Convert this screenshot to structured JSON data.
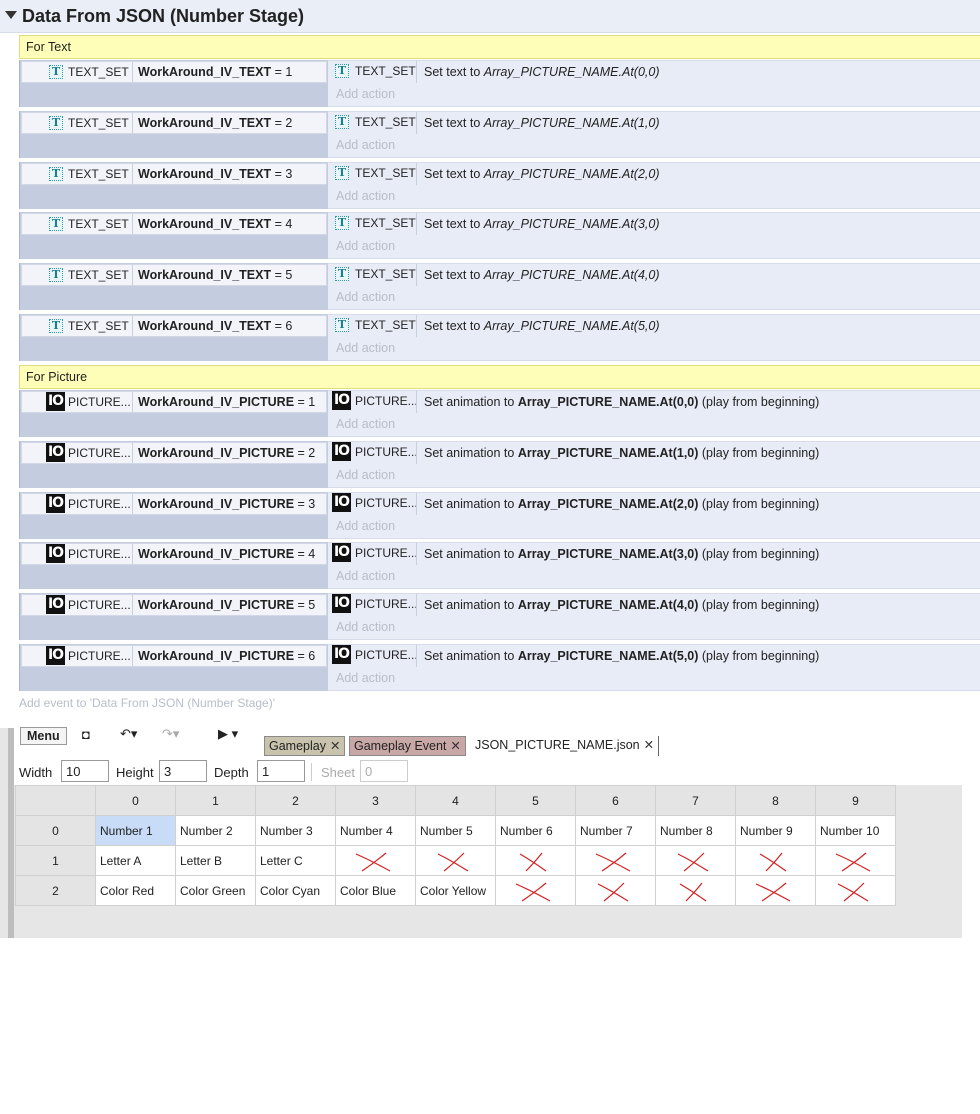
{
  "group": {
    "title": "Data From JSON (Number Stage)",
    "add_event": "Add event to 'Data From JSON (Number Stage)'"
  },
  "text_section": {
    "label": "For Text",
    "events": [
      {
        "obj": "TEXT_SET",
        "var": "WorkAround_IV_TEXT",
        "op": " = 1",
        "act_obj": "TEXT_SET",
        "act_prefix": "Set text to ",
        "act_expr": "Array_PICTURE_NAME.At(0,0)",
        "add_action": "Add action"
      },
      {
        "obj": "TEXT_SET",
        "var": "WorkAround_IV_TEXT",
        "op": " = 2",
        "act_obj": "TEXT_SET",
        "act_prefix": "Set text to ",
        "act_expr": "Array_PICTURE_NAME.At(1,0)",
        "add_action": "Add action"
      },
      {
        "obj": "TEXT_SET",
        "var": "WorkAround_IV_TEXT",
        "op": " = 3",
        "act_obj": "TEXT_SET",
        "act_prefix": "Set text to ",
        "act_expr": "Array_PICTURE_NAME.At(2,0)",
        "add_action": "Add action"
      },
      {
        "obj": "TEXT_SET",
        "var": "WorkAround_IV_TEXT",
        "op": " = 4",
        "act_obj": "TEXT_SET",
        "act_prefix": "Set text to ",
        "act_expr": "Array_PICTURE_NAME.At(3,0)",
        "add_action": "Add action"
      },
      {
        "obj": "TEXT_SET",
        "var": "WorkAround_IV_TEXT",
        "op": " = 5",
        "act_obj": "TEXT_SET",
        "act_prefix": "Set text to ",
        "act_expr": "Array_PICTURE_NAME.At(4,0)",
        "add_action": "Add action"
      },
      {
        "obj": "TEXT_SET",
        "var": "WorkAround_IV_TEXT",
        "op": " = 6",
        "act_obj": "TEXT_SET",
        "act_prefix": "Set text to ",
        "act_expr": "Array_PICTURE_NAME.At(5,0)",
        "add_action": "Add action"
      }
    ]
  },
  "picture_section": {
    "label": "For Picture",
    "events": [
      {
        "obj": "PICTURE...",
        "var": "WorkAround_IV_PICTURE",
        "op": " = 1",
        "act_obj": "PICTURE...",
        "act_prefix": "Set animation to ",
        "act_expr": "Array_PICTURE_NAME.At(0,0)",
        "act_suffix": " (play from beginning)",
        "add_action": "Add action"
      },
      {
        "obj": "PICTURE...",
        "var": "WorkAround_IV_PICTURE",
        "op": " = 2",
        "act_obj": "PICTURE...",
        "act_prefix": "Set animation to ",
        "act_expr": "Array_PICTURE_NAME.At(1,0)",
        "act_suffix": " (play from beginning)",
        "add_action": "Add action"
      },
      {
        "obj": "PICTURE...",
        "var": "WorkAround_IV_PICTURE",
        "op": " = 3",
        "act_obj": "PICTURE...",
        "act_prefix": "Set animation to ",
        "act_expr": "Array_PICTURE_NAME.At(2,0)",
        "act_suffix": " (play from beginning)",
        "add_action": "Add action"
      },
      {
        "obj": "PICTURE...",
        "var": "WorkAround_IV_PICTURE",
        "op": " = 4",
        "act_obj": "PICTURE...",
        "act_prefix": "Set animation to ",
        "act_expr": "Array_PICTURE_NAME.At(3,0)",
        "act_suffix": " (play from beginning)",
        "add_action": "Add action"
      },
      {
        "obj": "PICTURE...",
        "var": "WorkAround_IV_PICTURE",
        "op": " = 5",
        "act_obj": "PICTURE...",
        "act_prefix": "Set animation to ",
        "act_expr": "Array_PICTURE_NAME.At(4,0)",
        "act_suffix": " (play from beginning)",
        "add_action": "Add action"
      },
      {
        "obj": "PICTURE...",
        "var": "WorkAround_IV_PICTURE",
        "op": " = 6",
        "act_obj": "PICTURE...",
        "act_prefix": "Set animation to ",
        "act_expr": "Array_PICTURE_NAME.At(5,0)",
        "act_suffix": " (play from beginning)",
        "add_action": "Add action"
      }
    ]
  },
  "editor": {
    "menu_label": "Menu",
    "tabs": [
      {
        "label": "Gameplay",
        "close": "✕"
      },
      {
        "label": "Gameplay Event",
        "close": "✕"
      },
      {
        "label": "JSON_PICTURE_NAME.json",
        "close": "✕"
      }
    ],
    "dims": {
      "width_label": "Width",
      "width_value": "10",
      "height_label": "Height",
      "height_value": "3",
      "depth_label": "Depth",
      "depth_value": "1",
      "sheet_label": "Sheet",
      "sheet_value": "0"
    },
    "columns": [
      "0",
      "1",
      "2",
      "3",
      "4",
      "5",
      "6",
      "7",
      "8",
      "9"
    ],
    "rows": [
      {
        "label": "0",
        "cells": [
          "Number 1",
          "Number 2",
          "Number 3",
          "Number 4",
          "Number 5",
          "Number 6",
          "Number 7",
          "Number 8",
          "Number 9",
          "Number 10"
        ]
      },
      {
        "label": "1",
        "cells": [
          "Letter A",
          "Letter B",
          "Letter C",
          "",
          "",
          "",
          "",
          "",
          "",
          ""
        ]
      },
      {
        "label": "2",
        "cells": [
          "Color Red",
          "Color Green",
          "Color Cyan",
          "Color Blue",
          "Color Yellow",
          "",
          "",
          "",
          "",
          ""
        ]
      }
    ],
    "crossed_cells": {
      "row1": [
        3,
        4,
        5,
        6,
        7,
        8,
        9
      ],
      "row2": [
        5,
        6,
        7,
        8,
        9
      ]
    },
    "mark_color": "#d22020",
    "selected_cell": "0,0"
  }
}
